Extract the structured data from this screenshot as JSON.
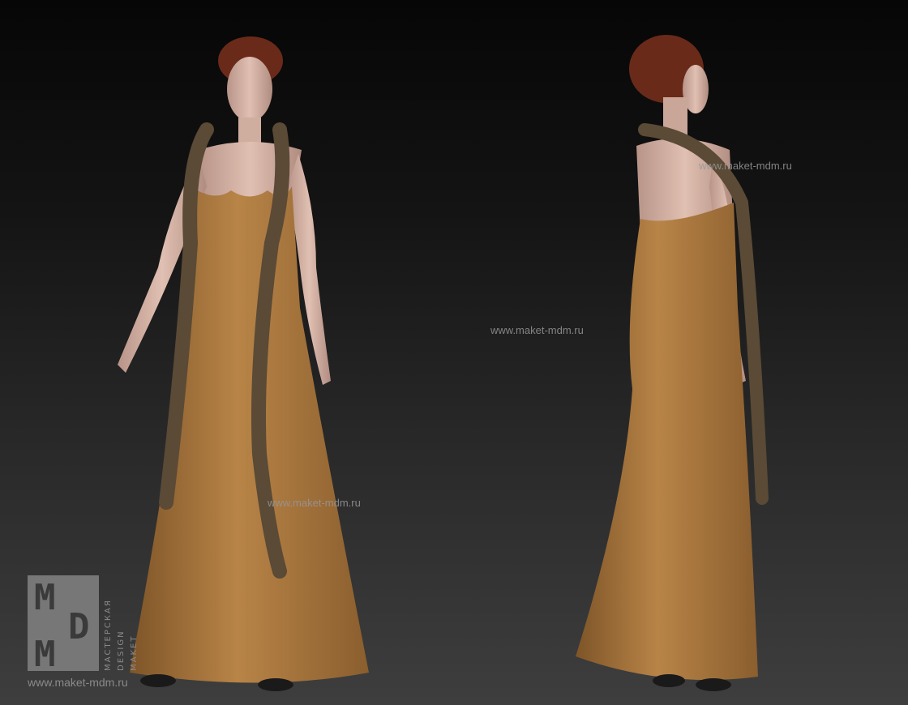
{
  "watermarks": {
    "top_right": "www.maket-mdm.ru",
    "center": "www.maket-mdm.ru",
    "lower_center": "www.maket-mdm.ru"
  },
  "logo": {
    "letters": [
      "M",
      "D",
      "M"
    ],
    "line1": "МАСТЕРСКАЯ",
    "line2": "DESIGN",
    "line3": "MAKET",
    "url": "www.maket-mdm.ru"
  },
  "colors": {
    "dress": "#a9773f",
    "skin": "#d9b7a8",
    "hair": "#6a2a1a",
    "scarf": "#5a4a36"
  }
}
